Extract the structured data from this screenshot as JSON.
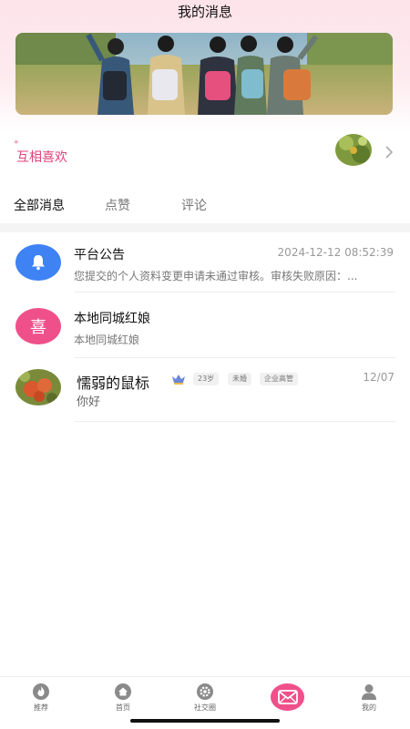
{
  "header": {
    "title": "我的消息"
  },
  "mutual_likes": {
    "label": "互相喜欢"
  },
  "tabs": [
    {
      "label": "全部消息",
      "active": true
    },
    {
      "label": "点赞",
      "active": false
    },
    {
      "label": "评论",
      "active": false
    }
  ],
  "messages": [
    {
      "title": "平台公告",
      "time": "2024-12-12 08:52:39",
      "preview": "您提交的个人资料变更申请未通过审核。审核失败原因：...",
      "icon": "bell-icon",
      "icon_color": "#3f82f4"
    },
    {
      "title": "本地同城红娘",
      "preview": "本地同城红娘",
      "avatar_text": "喜",
      "avatar_color": "#f0508a"
    },
    {
      "title": "懦弱的鼠标",
      "time": "12/07",
      "preview": "你好",
      "tags": [
        "23岁",
        "未婚",
        "企业高管"
      ],
      "badge_icon": "vip-badge-icon"
    }
  ],
  "bottom_nav": [
    {
      "label": "推荐",
      "icon": "fire-icon"
    },
    {
      "label": "首页",
      "icon": "home-icon"
    },
    {
      "label": "社交圈",
      "icon": "gear-icon"
    },
    {
      "label": "",
      "icon": "mail-icon",
      "active": true
    },
    {
      "label": "我的",
      "icon": "person-icon"
    }
  ],
  "colors": {
    "accent_pink": "#f0508a",
    "mutual_text": "#e0427a",
    "notice_blue": "#3f82f4"
  }
}
